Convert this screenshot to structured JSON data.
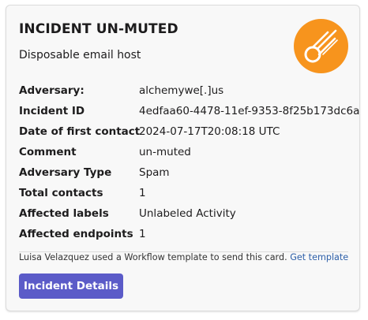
{
  "card": {
    "title": "INCIDENT UN-MUTED",
    "subtitle": "Disposable email host",
    "logo_icon": "comet-icon",
    "logo_color": "#f7941d"
  },
  "fields": [
    {
      "label": "Adversary:",
      "value": "alchemywe[.]us"
    },
    {
      "label": "Incident ID",
      "value": "4edfaa60-4478-11ef-9353-8f25b173dc6a"
    },
    {
      "label": "Date of first contact",
      "value": "2024-07-17T20:08:18 UTC"
    },
    {
      "label": "Comment",
      "value": "un-muted"
    },
    {
      "label": "Adversary Type",
      "value": "Spam"
    },
    {
      "label": "Total contacts",
      "value": "1"
    },
    {
      "label": "Affected labels",
      "value": "Unlabeled Activity"
    },
    {
      "label": "Affected endpoints",
      "value": "1"
    }
  ],
  "footer": {
    "text": "Luisa Velazquez used a Workflow template to send this card.",
    "link_label": "Get template",
    "link_color": "#2d5fa8"
  },
  "actions": {
    "details_label": "Incident Details",
    "button_color": "#5b5bc8"
  }
}
